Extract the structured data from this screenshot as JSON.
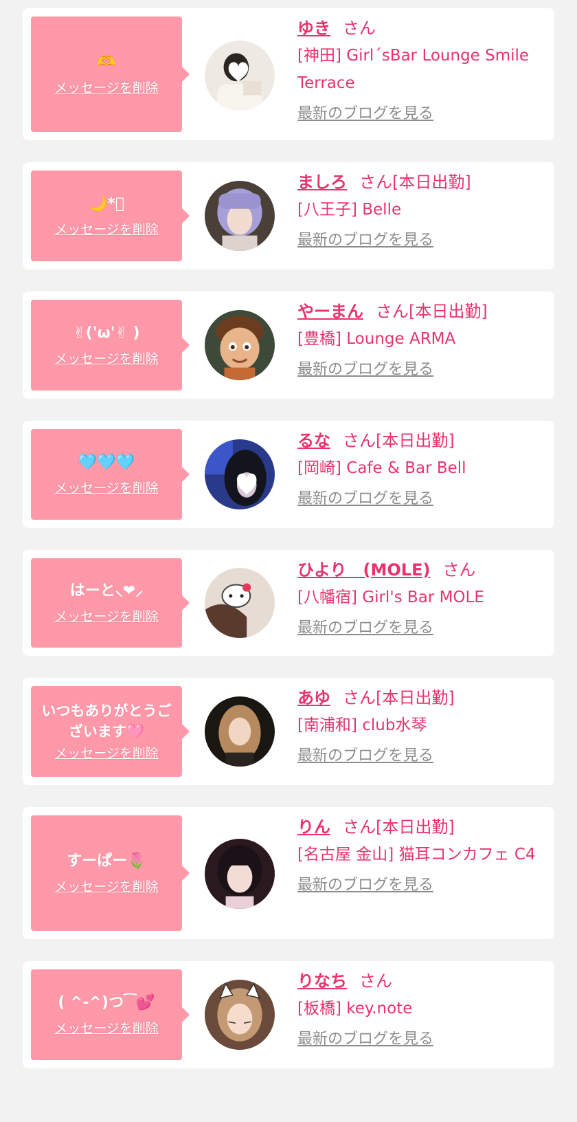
{
  "common": {
    "delete_label": "メッセージを削除",
    "san_label": "さん",
    "blog_label": "最新のブログを見る"
  },
  "colors": {
    "background": "#f2f2f2",
    "card": "#ffffff",
    "bubble": "#ff98a8",
    "accent": "#e8336b",
    "blog_link": "#8c8c8c"
  },
  "entries": [
    {
      "message": "🫶",
      "name": "ゆき",
      "status": "",
      "shop": "[神田] Girl´sBar Lounge Smile Terrace",
      "avatar_icon": "photo-avatar"
    },
    {
      "message": "🌙*ﾟ",
      "name": "ましろ",
      "status": "[本日出勤]",
      "shop": "[八王子] Belle",
      "avatar_icon": "photo-avatar"
    },
    {
      "message": "✌︎('ω'✌︎ )",
      "name": "やーまん",
      "status": "[本日出勤]",
      "shop": "[豊橋] Lounge ARMA",
      "avatar_icon": "cartoon-avatar"
    },
    {
      "message": "🩵🩵🩵",
      "name": "るな",
      "status": "[本日出勤]",
      "shop": "[岡崎] Cafe & Bar Bell",
      "avatar_icon": "photo-avatar"
    },
    {
      "message": "はーと⸜❤︎⸝",
      "name": "ひより　(MOLE)",
      "status": "",
      "shop": "[八幡宿] Girl's Bar MOLE",
      "avatar_icon": "photo-avatar"
    },
    {
      "message": "いつもありがとうございます🩷",
      "name": "あゆ",
      "status": "[本日出勤]",
      "shop": "[南浦和] club水琴",
      "avatar_icon": "photo-avatar"
    },
    {
      "message": "すーぱー🌷",
      "name": "りん",
      "status": "[本日出勤]",
      "shop": "[名古屋 金山] 猫耳コンカフェ C4",
      "avatar_icon": "photo-avatar"
    },
    {
      "message": "( ^-^)つ⁀💕",
      "name": "りなち",
      "status": "",
      "shop": "[板橋] key.note",
      "avatar_icon": "photo-avatar"
    }
  ]
}
